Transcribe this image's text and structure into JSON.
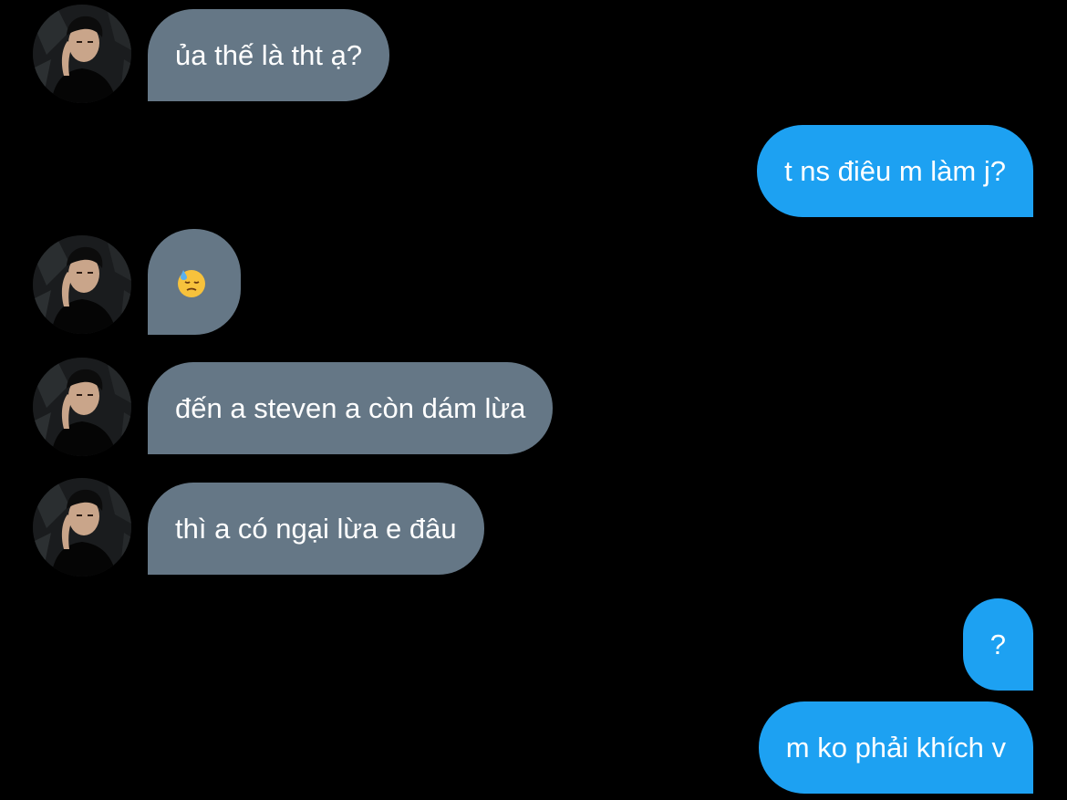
{
  "colors": {
    "background": "#000000",
    "received_bubble": "#657786",
    "sent_bubble": "#1da1f2",
    "text": "#ffffff"
  },
  "messages": [
    {
      "direction": "received",
      "text": "ủa thế là tht ạ?"
    },
    {
      "direction": "sent",
      "text": "t ns điêu m làm j?"
    },
    {
      "direction": "received",
      "text": "",
      "icon": "downcast-face-with-sweat-emoji"
    },
    {
      "direction": "received",
      "text": "đến a steven a còn dám lừa"
    },
    {
      "direction": "received",
      "text": "thì a có ngại lừa e đâu"
    },
    {
      "direction": "sent",
      "text": "?"
    },
    {
      "direction": "sent",
      "text": "m ko phải khích v"
    }
  ],
  "avatar": {
    "icon": "user-avatar"
  }
}
